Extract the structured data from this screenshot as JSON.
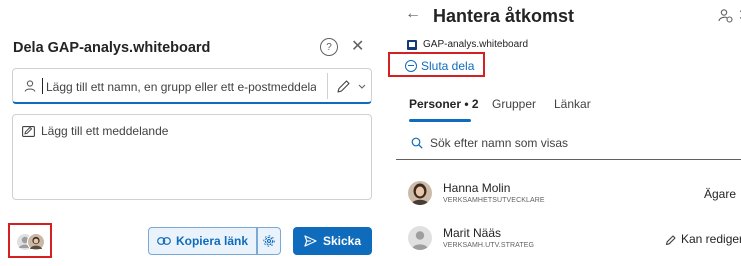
{
  "share_dialog": {
    "title": "Dela GAP-analys.whiteboard",
    "help_label": "?",
    "close_label": "✕",
    "recipient_placeholder": "Lägg till ett namn, en grupp eller ett e-postmeddelande",
    "message_placeholder": "Lägg till ett meddelande",
    "copy_link_label": "Kopiera länk",
    "send_label": "Skicka"
  },
  "manage_access": {
    "back_label": "←",
    "title": "Hantera åtkomst",
    "close_label": "✕",
    "file_name": "GAP-analys.whiteboard",
    "stop_sharing_label": "Sluta dela",
    "tabs": [
      {
        "label": "Personer • 2",
        "active": true
      },
      {
        "label": "Grupper",
        "active": false
      },
      {
        "label": "Länkar",
        "active": false
      }
    ],
    "search_placeholder": "Sök efter namn som visas",
    "people": [
      {
        "name": "Hanna Molin",
        "title": "VERKSAMHETSUTVECKLARE",
        "role": "Ägare",
        "icon": "owner"
      },
      {
        "name": "Marit Nääs",
        "title": "VERKSAMH.UTV.STRATEG",
        "role": "Kan redigera",
        "icon": "edit-pencil-icon"
      }
    ]
  },
  "colors": {
    "accent": "#0f6cbd",
    "highlight": "#d42020",
    "button_light": "#eaf3fb"
  }
}
